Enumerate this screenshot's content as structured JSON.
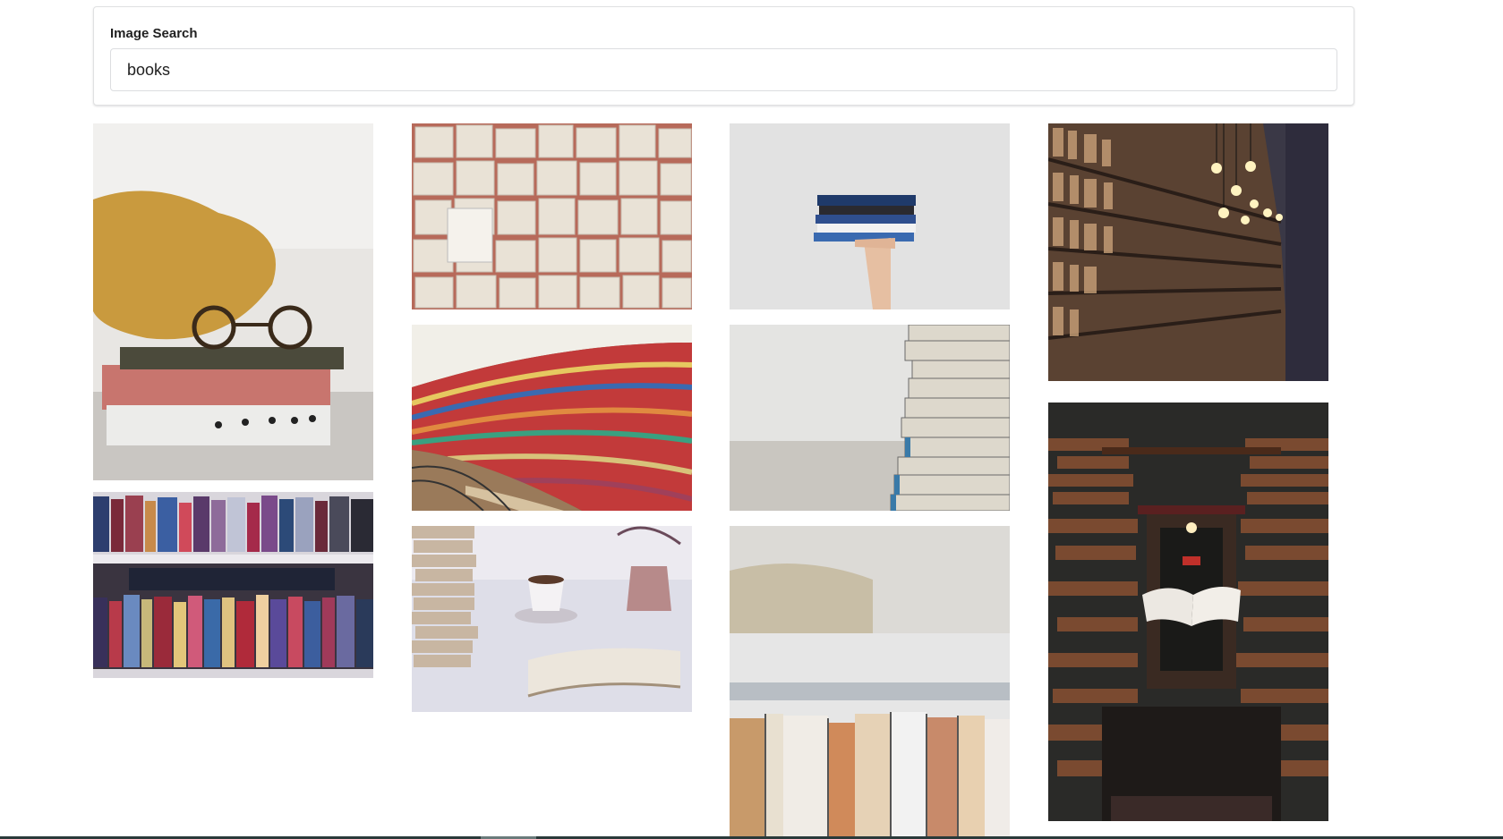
{
  "search": {
    "label": "Image Search",
    "value": "books"
  },
  "results": {
    "images": [
      {
        "name": "image-glasses-on-books"
      },
      {
        "name": "image-bookshelf-blurred"
      },
      {
        "name": "image-open-pages-collage"
      },
      {
        "name": "image-curved-library-shelves"
      },
      {
        "name": "image-teacup-and-open-book"
      },
      {
        "name": "image-hand-holding-books"
      },
      {
        "name": "image-stacked-books-side"
      },
      {
        "name": "image-books-spines-bottom"
      },
      {
        "name": "image-library-aisle-lights"
      },
      {
        "name": "image-floating-book-bookstore"
      }
    ]
  },
  "colors": {
    "border": "#e0e1e2",
    "text": "#212121"
  }
}
